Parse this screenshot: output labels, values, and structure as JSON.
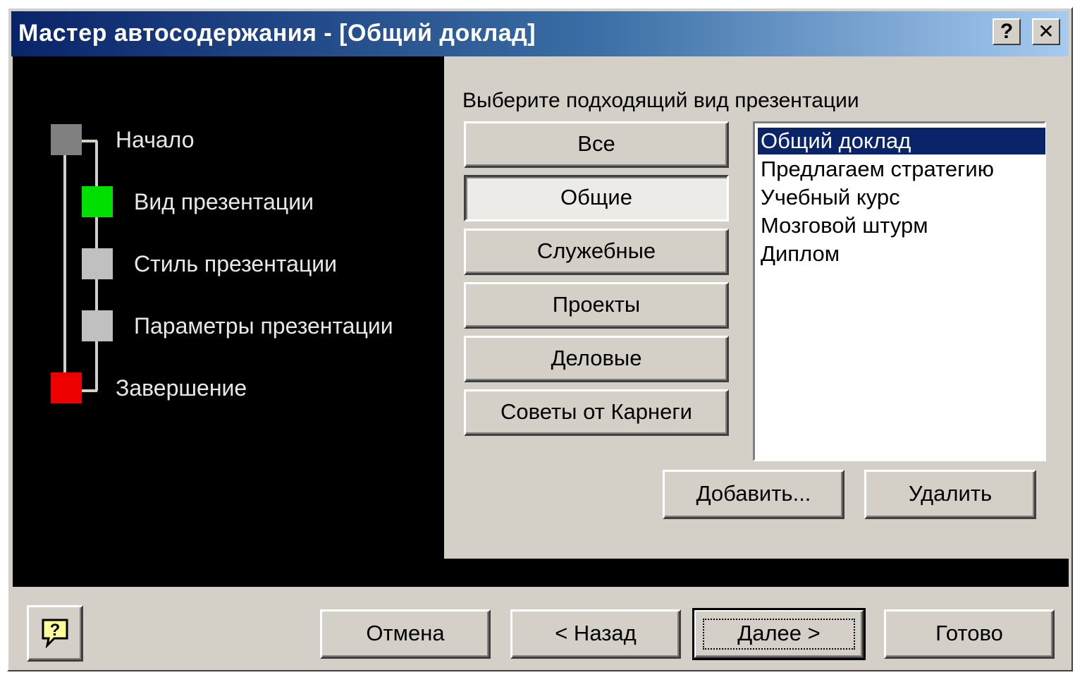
{
  "window": {
    "title": "Мастер автосодержания - [Общий доклад]",
    "help_button": "?",
    "close_button": "✕"
  },
  "steps": [
    {
      "label": "Начало",
      "color": "#808080"
    },
    {
      "label": "Вид презентации",
      "color": "#00e000"
    },
    {
      "label": "Стиль презентации",
      "color": "#c0c0c0"
    },
    {
      "label": "Параметры презентации",
      "color": "#c0c0c0"
    },
    {
      "label": "Завершение",
      "color": "#ee0000"
    }
  ],
  "main": {
    "prompt": "Выберите подходящий вид презентации",
    "categories": [
      {
        "label": "Все",
        "pressed": false
      },
      {
        "label": "Общие",
        "pressed": true
      },
      {
        "label": "Служебные",
        "pressed": false
      },
      {
        "label": "Проекты",
        "pressed": false
      },
      {
        "label": "Деловые",
        "pressed": false
      },
      {
        "label": "Советы от Карнеги",
        "pressed": false
      }
    ],
    "list_items": [
      {
        "label": "Общий доклад",
        "selected": true
      },
      {
        "label": "Предлагаем стратегию",
        "selected": false
      },
      {
        "label": "Учебный курс",
        "selected": false
      },
      {
        "label": "Мозговой штурм",
        "selected": false
      },
      {
        "label": "Диплом",
        "selected": false
      }
    ],
    "add_label": "Добавить...",
    "delete_label": "Удалить"
  },
  "footer": {
    "help_icon": "?",
    "cancel_label": "Отмена",
    "back_label": "< Назад",
    "next_label": "Далее >",
    "finish_label": "Готово"
  }
}
